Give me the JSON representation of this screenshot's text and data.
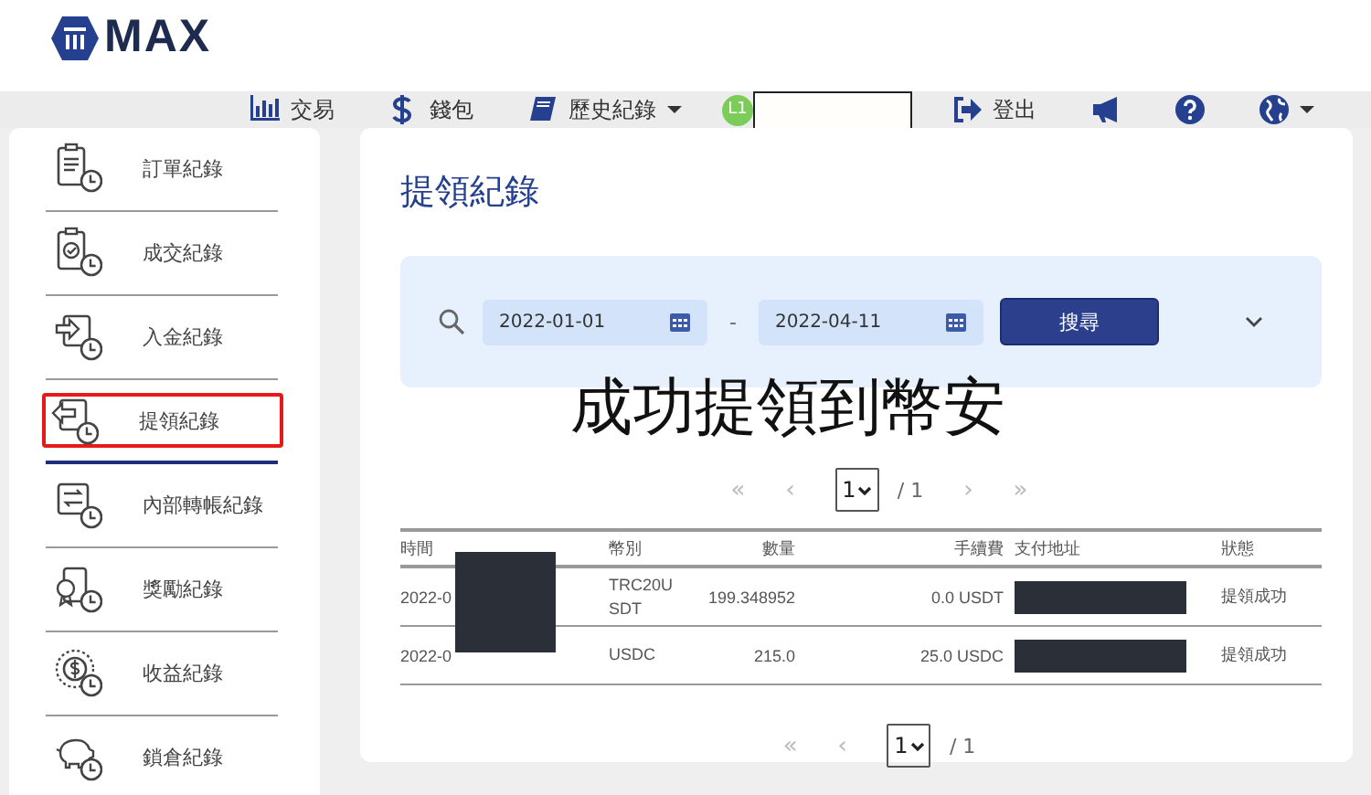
{
  "logo": {
    "text": "MAX"
  },
  "nav": [
    {
      "kind": "chart",
      "label": "交易"
    },
    {
      "kind": "dollar",
      "label": "錢包"
    },
    {
      "kind": "book",
      "label": "歷史紀錄",
      "dropdown": true
    },
    {
      "kind": "level",
      "label": "L1"
    },
    {
      "kind": "redacted"
    },
    {
      "kind": "logout",
      "label": "登出"
    },
    {
      "kind": "megaphone"
    },
    {
      "kind": "help"
    },
    {
      "kind": "globe",
      "dropdown": true
    }
  ],
  "sidebar": {
    "items": [
      {
        "kind": "order",
        "label": "訂單紀錄",
        "selected": false,
        "highlighted": false
      },
      {
        "kind": "trade",
        "label": "成交紀錄",
        "selected": false,
        "highlighted": false
      },
      {
        "kind": "deposit",
        "label": "入金紀錄",
        "selected": false,
        "highlighted": false
      },
      {
        "kind": "withdraw",
        "label": "提領紀錄",
        "selected": true,
        "highlighted": true
      },
      {
        "kind": "transfer",
        "label": "內部轉帳紀錄",
        "selected": false,
        "highlighted": false
      },
      {
        "kind": "reward",
        "label": "獎勵紀錄",
        "selected": false,
        "highlighted": false
      },
      {
        "kind": "earn",
        "label": "收益紀錄",
        "selected": false,
        "highlighted": false
      },
      {
        "kind": "lock",
        "label": "鎖倉紀錄",
        "selected": false,
        "highlighted": false
      }
    ]
  },
  "main": {
    "title": "提領紀錄",
    "filter": {
      "from": "2022-01-01",
      "separator": "-",
      "to": "2022-04-11",
      "button": "搜尋"
    },
    "caption": "成功提領到幣安",
    "pagination_top": {
      "first": "«",
      "prev": "‹",
      "page": "1",
      "total": "/ 1",
      "next": "›",
      "last": "»"
    },
    "table": {
      "columns": [
        "時間",
        "幣別",
        "數量",
        "手續費",
        "支付地址",
        "狀態"
      ],
      "rows": [
        {
          "time": "2022-0",
          "currency": "TRC20USDT",
          "amount": "199.348952",
          "fee": "0.0 USDT",
          "status": "提領成功"
        },
        {
          "time": "2022-0",
          "currency": "USDC",
          "amount": "215.0",
          "fee": "25.0 USDC",
          "status": "提領成功"
        }
      ]
    },
    "pagination_bottom": {
      "first": "«",
      "prev": "‹",
      "page": "1",
      "total": "/ 1"
    }
  }
}
